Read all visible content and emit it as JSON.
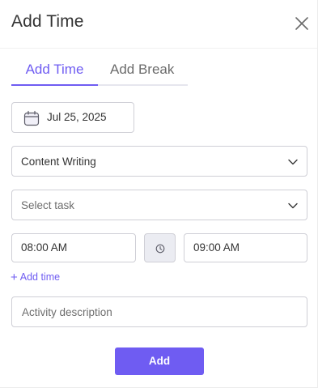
{
  "dialog": {
    "title": "Add Time",
    "close_icon": "close-icon"
  },
  "tabs": [
    {
      "label": "Add Time",
      "active": true
    },
    {
      "label": "Add Break",
      "active": false
    }
  ],
  "date": {
    "icon": "calendar-icon",
    "value": "Jul 25, 2025"
  },
  "project_select": {
    "value": "Content Writing",
    "icon": "chevron-down-icon"
  },
  "task_select": {
    "placeholder": "Select task",
    "icon": "chevron-down-icon"
  },
  "time": {
    "start": "08:00 AM",
    "end": "09:00 AM",
    "icon": "clock-icon"
  },
  "add_time_link": {
    "label": "Add time"
  },
  "description": {
    "placeholder": "Activity description"
  },
  "submit": {
    "label": "Add"
  },
  "colors": {
    "accent": "#6f5cf2",
    "border": "#cfcfd6",
    "clock_bg": "#ebecf2"
  }
}
